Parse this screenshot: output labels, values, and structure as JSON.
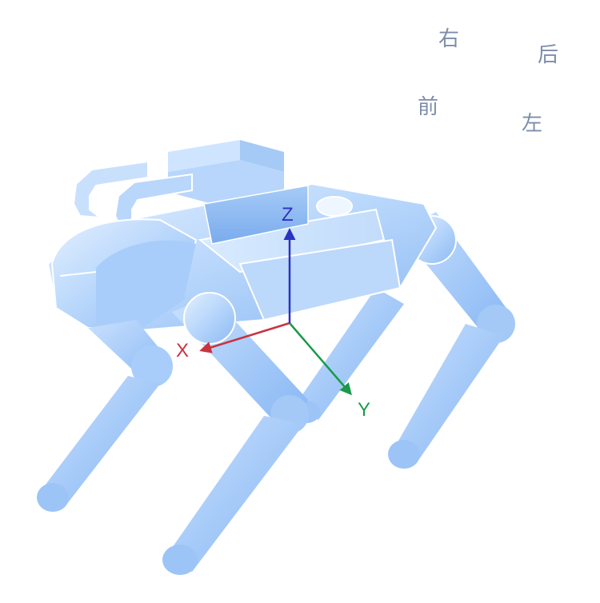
{
  "directions": {
    "right": "右",
    "back": "后",
    "front": "前",
    "left": "左"
  },
  "axes": [
    {
      "id": "x",
      "label": "X",
      "color": "#c8333f"
    },
    {
      "id": "y",
      "label": "Y",
      "color": "#1a9a4a"
    },
    {
      "id": "z",
      "label": "Z",
      "color": "#2a33c2"
    }
  ],
  "colors": {
    "body_light": "#d6e9ff",
    "body_mid": "#a9cdfa",
    "body_dark": "#7fb0f2",
    "outline": "#ffffff",
    "direction_text": "#7d8da8"
  }
}
